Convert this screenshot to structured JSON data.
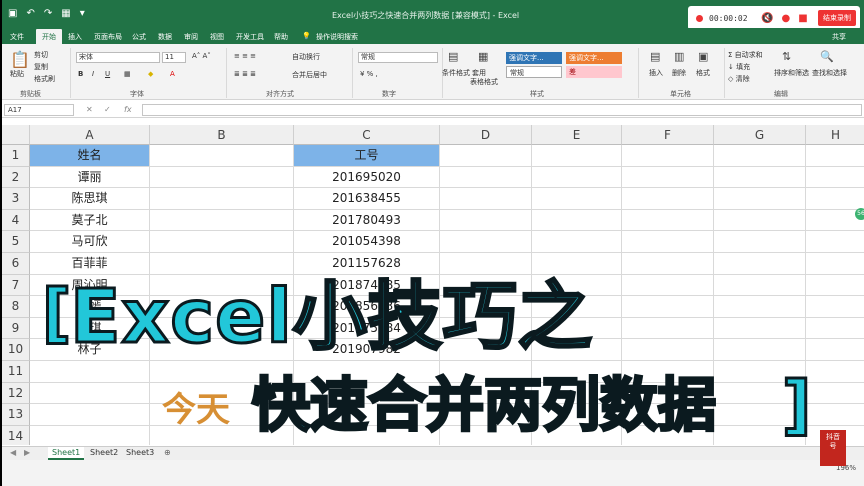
{
  "window": {
    "title": "Excel小技巧之快速合并两列数据 [兼容模式] - Excel",
    "quick_access": [
      "💾",
      "↶",
      "↷",
      "▦",
      "▾"
    ]
  },
  "recorder": {
    "time": "00:00:02",
    "stop_label": "结束录制"
  },
  "tabs": [
    {
      "label": "文件"
    },
    {
      "label": "开始"
    },
    {
      "label": "插入"
    },
    {
      "label": "页面布局"
    },
    {
      "label": "公式"
    },
    {
      "label": "数据"
    },
    {
      "label": "审阅"
    },
    {
      "label": "视图"
    },
    {
      "label": "开发工具"
    },
    {
      "label": "帮助"
    },
    {
      "label": "操作说明搜索"
    }
  ],
  "share_label": "共享",
  "ribbon": {
    "clipboard": {
      "paste": "粘贴",
      "cut": "剪切",
      "copy": "复制",
      "format_painter": "格式刷",
      "label": "剪贴板"
    },
    "font": {
      "name": "宋体",
      "size": "11",
      "label": "字体"
    },
    "alignment": {
      "wrap": "自动换行",
      "merge": "合并后居中",
      "label": "对齐方式"
    },
    "number": {
      "format": "常规",
      "label": "数字"
    },
    "styles": {
      "conditional": "条件格式",
      "table": "套用\n表格格式",
      "cell_styles": "单元格样式",
      "s1": "强调文字...",
      "s2": "强调文字...",
      "normal": "常规",
      "bad": "差",
      "label": "样式"
    },
    "cells": {
      "insert": "插入",
      "delete": "删除",
      "format": "格式",
      "label": "单元格"
    },
    "editing": {
      "autosum": "自动求和",
      "fill": "填充",
      "clear": "清除",
      "sort": "排序和筛选",
      "find": "查找和选择",
      "label": "编辑"
    }
  },
  "formula_bar": {
    "name_box": "A17",
    "fx": "fx"
  },
  "columns": [
    "A",
    "B",
    "C",
    "D",
    "E",
    "F",
    "G",
    "H"
  ],
  "rows": [
    {
      "n": "1",
      "a": "姓名",
      "c": "工号"
    },
    {
      "n": "2",
      "a": "谭丽",
      "c": "201695020"
    },
    {
      "n": "3",
      "a": "陈思琪",
      "c": "201638455"
    },
    {
      "n": "4",
      "a": "莫子北",
      "c": "201780493"
    },
    {
      "n": "5",
      "a": "马可欣",
      "c": "201054398"
    },
    {
      "n": "6",
      "a": "百菲菲",
      "c": "201157628"
    },
    {
      "n": "7",
      "a": "周沁明",
      "c": "201874385"
    },
    {
      "n": "8",
      "a": "刘嫣",
      "c": "201856236"
    },
    {
      "n": "9",
      "a": "杨琪",
      "c": "201675384"
    },
    {
      "n": "10",
      "a": "林子",
      "c": "201907982"
    },
    {
      "n": "11",
      "a": "",
      "c": ""
    },
    {
      "n": "12",
      "a": "",
      "c": ""
    },
    {
      "n": "13",
      "a": "",
      "c": ""
    },
    {
      "n": "14",
      "a": "",
      "c": ""
    }
  ],
  "sheets": [
    "Sheet1",
    "Sheet2",
    "Sheet3"
  ],
  "zoom": "196%",
  "overlay": {
    "title_line1": "Excel小技巧之",
    "title_line2": "快速合并两列数据",
    "subtitle": "今天",
    "bracket_left": "[",
    "bracket_right": "]"
  },
  "logo": "抖音\n号",
  "side_badge": "56"
}
